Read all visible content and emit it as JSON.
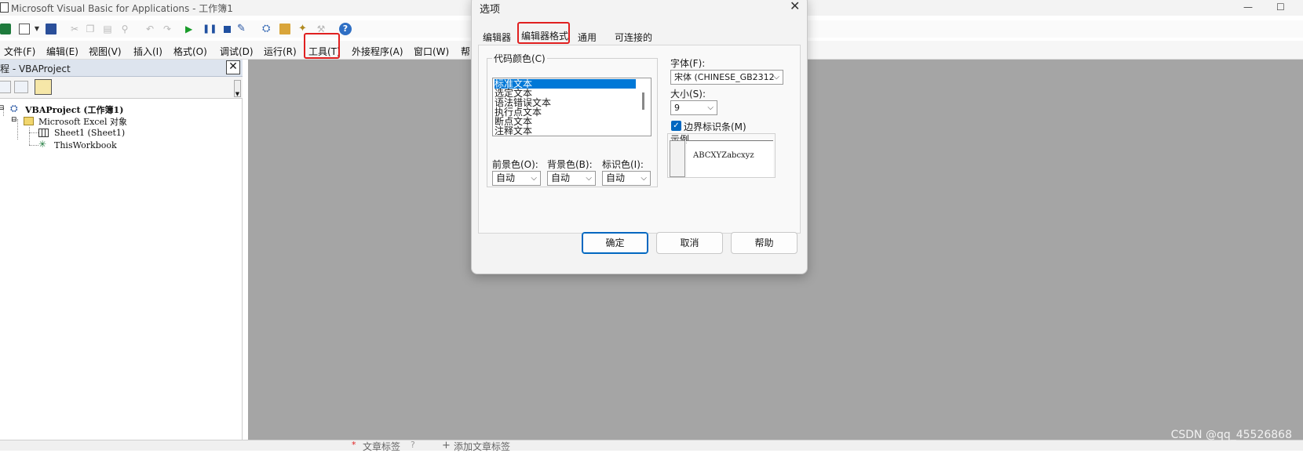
{
  "window": {
    "title": "Microsoft Visual Basic for Applications - 工作簿1",
    "minimize_glyph": "—",
    "maximize_glyph": "☐"
  },
  "menubar": {
    "items": [
      "文件(F)",
      "编辑(E)",
      "视图(V)",
      "插入(I)",
      "格式(O)",
      "调试(D)",
      "运行(R)",
      "工具(T)",
      "外接程序(A)",
      "窗口(W)",
      "帮"
    ]
  },
  "project": {
    "title": "程 - VBAProject",
    "close_glyph": "✕",
    "tree": {
      "root": "VBAProject (工作簿1)",
      "folder": "Microsoft Excel 对象",
      "sheet": "Sheet1 (Sheet1)",
      "workbook": "ThisWorkbook"
    }
  },
  "dialog": {
    "title": "选项",
    "close_glyph": "✕",
    "tabs": [
      "编辑器",
      "编辑器格式",
      "通用",
      "可连接的"
    ],
    "active_tab": "编辑器格式",
    "code_colors_label": "代码颜色(C)",
    "code_color_items": [
      "标准文本",
      "选定文本",
      "语法错误文本",
      "执行点文本",
      "断点文本",
      "注释文本"
    ],
    "selected_item": "标准文本",
    "foreground_label": "前景色(O):",
    "background_label": "背景色(B):",
    "indicator_label": "标识色(I):",
    "foreground_value": "自动",
    "background_value": "自动",
    "indicator_value": "自动",
    "font_label": "字体(F):",
    "font_value": "宋体 (CHINESE_GB2312",
    "size_label": "大小(S):",
    "size_value": "9",
    "margin_checkbox_label": "边界标识条(M)",
    "margin_checked": true,
    "sample_label": "示例",
    "sample_text": "ABCXYZabcxyz",
    "buttons": {
      "ok": "确定",
      "cancel": "取消",
      "help": "帮助"
    }
  },
  "footer": {
    "left_tab": "文章标签",
    "right_tab": "添加文章标签"
  },
  "watermark": "CSDN @qq_45526868",
  "colors": {
    "highlight": "#e02020",
    "selection": "#0078d7",
    "mdi_background": "#a5a5a5"
  }
}
